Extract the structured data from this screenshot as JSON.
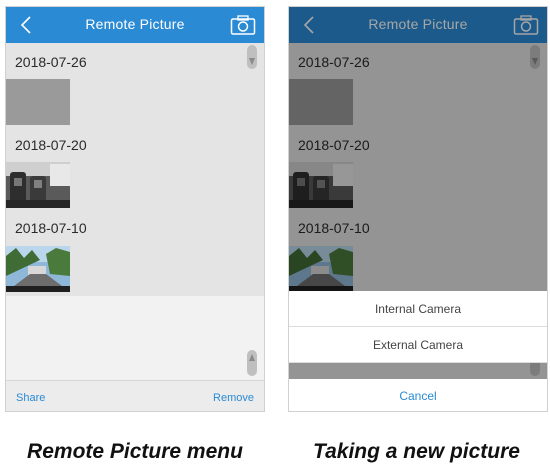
{
  "left_screen": {
    "header": {
      "title": "Remote Picture"
    },
    "groups": [
      {
        "date": "2018-07-26",
        "thumbnail": "blank"
      },
      {
        "date": "2018-07-20",
        "thumbnail": "car-interior"
      },
      {
        "date": "2018-07-10",
        "thumbnail": "street-view"
      }
    ],
    "footer": {
      "share_label": "Share",
      "remove_label": "Remove"
    }
  },
  "right_screen": {
    "header": {
      "title": "Remote Picture"
    },
    "groups": [
      {
        "date": "2018-07-26",
        "thumbnail": "blank"
      },
      {
        "date": "2018-07-20",
        "thumbnail": "car-interior"
      },
      {
        "date": "2018-07-10",
        "thumbnail": "street-view"
      }
    ],
    "action_sheet": {
      "options": [
        "Internal Camera",
        "External Camera"
      ],
      "cancel_label": "Cancel"
    }
  },
  "captions": {
    "left": "Remote Picture menu",
    "right": "Taking a new picture"
  },
  "colors": {
    "header_blue": "#2a8ad4",
    "link_blue": "#2a8ad4",
    "content_bg": "#e4e4e4"
  },
  "icons": [
    "back-arrow-icon",
    "camera-icon",
    "scroll-up-icon",
    "scroll-down-icon"
  ]
}
